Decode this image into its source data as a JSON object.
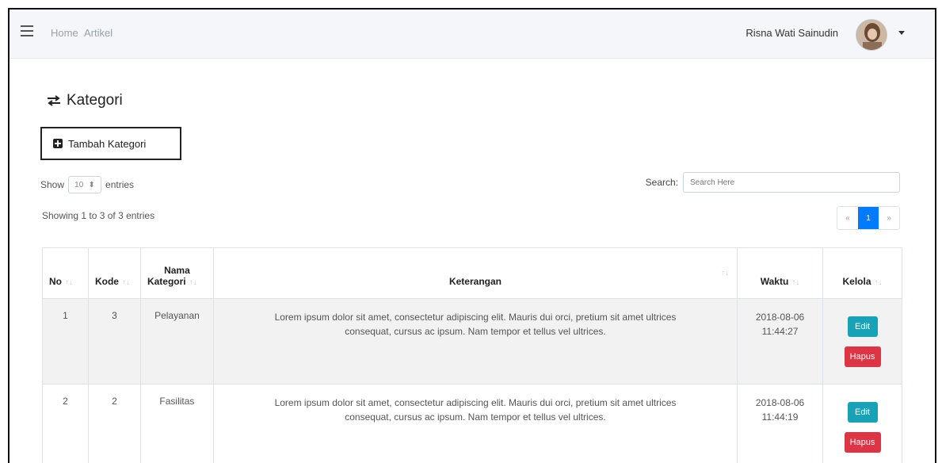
{
  "navbar": {
    "links": [
      "Home",
      "Artikel"
    ],
    "user_name": "Risna Wati Sainudin"
  },
  "page": {
    "title": "Kategori",
    "add_button": "Tambah Kategori"
  },
  "controls": {
    "show_label": "Show",
    "entries_value": "10",
    "entries_label": "entries",
    "search_label": "Search:",
    "search_placeholder": "Search Here",
    "info": "Showing 1 to 3 of 3 entries",
    "pager": {
      "prev": "«",
      "current": "1",
      "next": "»"
    }
  },
  "table": {
    "headers": {
      "no": "No",
      "kode": "Kode",
      "nama_line1": "Nama",
      "nama_line2": "Kategori",
      "keterangan": "Keterangan",
      "waktu": "Waktu",
      "kelola": "Kelola"
    },
    "sort_glyph": "↑↓",
    "rows": [
      {
        "no": "1",
        "kode": "3",
        "nama": "Pelayanan",
        "keterangan_1": "Lorem ipsum dolor sit amet, consectetur adipiscing elit. Mauris dui orci, pretium sit amet ultrices",
        "keterangan_2": "consequat, cursus ac ipsum. Nam tempor et tellus vel ultrices.",
        "waktu_date": "2018-08-06",
        "waktu_time": "11:44:27",
        "edit": "Edit",
        "hapus": "Hapus"
      },
      {
        "no": "2",
        "kode": "2",
        "nama": "Fasilitas",
        "keterangan_1": "Lorem ipsum dolor sit amet, consectetur adipiscing elit. Mauris dui orci, pretium sit amet ultrices",
        "keterangan_2": "consequat, cursus ac ipsum. Nam tempor et tellus vel ultrices.",
        "waktu_date": "2018-08-06",
        "waktu_time": "11:44:19",
        "edit": "Edit",
        "hapus": "Hapus"
      }
    ]
  },
  "colors": {
    "primary": "#007bff",
    "info": "#17a2b8",
    "danger": "#dc3545",
    "navbar_bg": "#f4f6f9"
  }
}
